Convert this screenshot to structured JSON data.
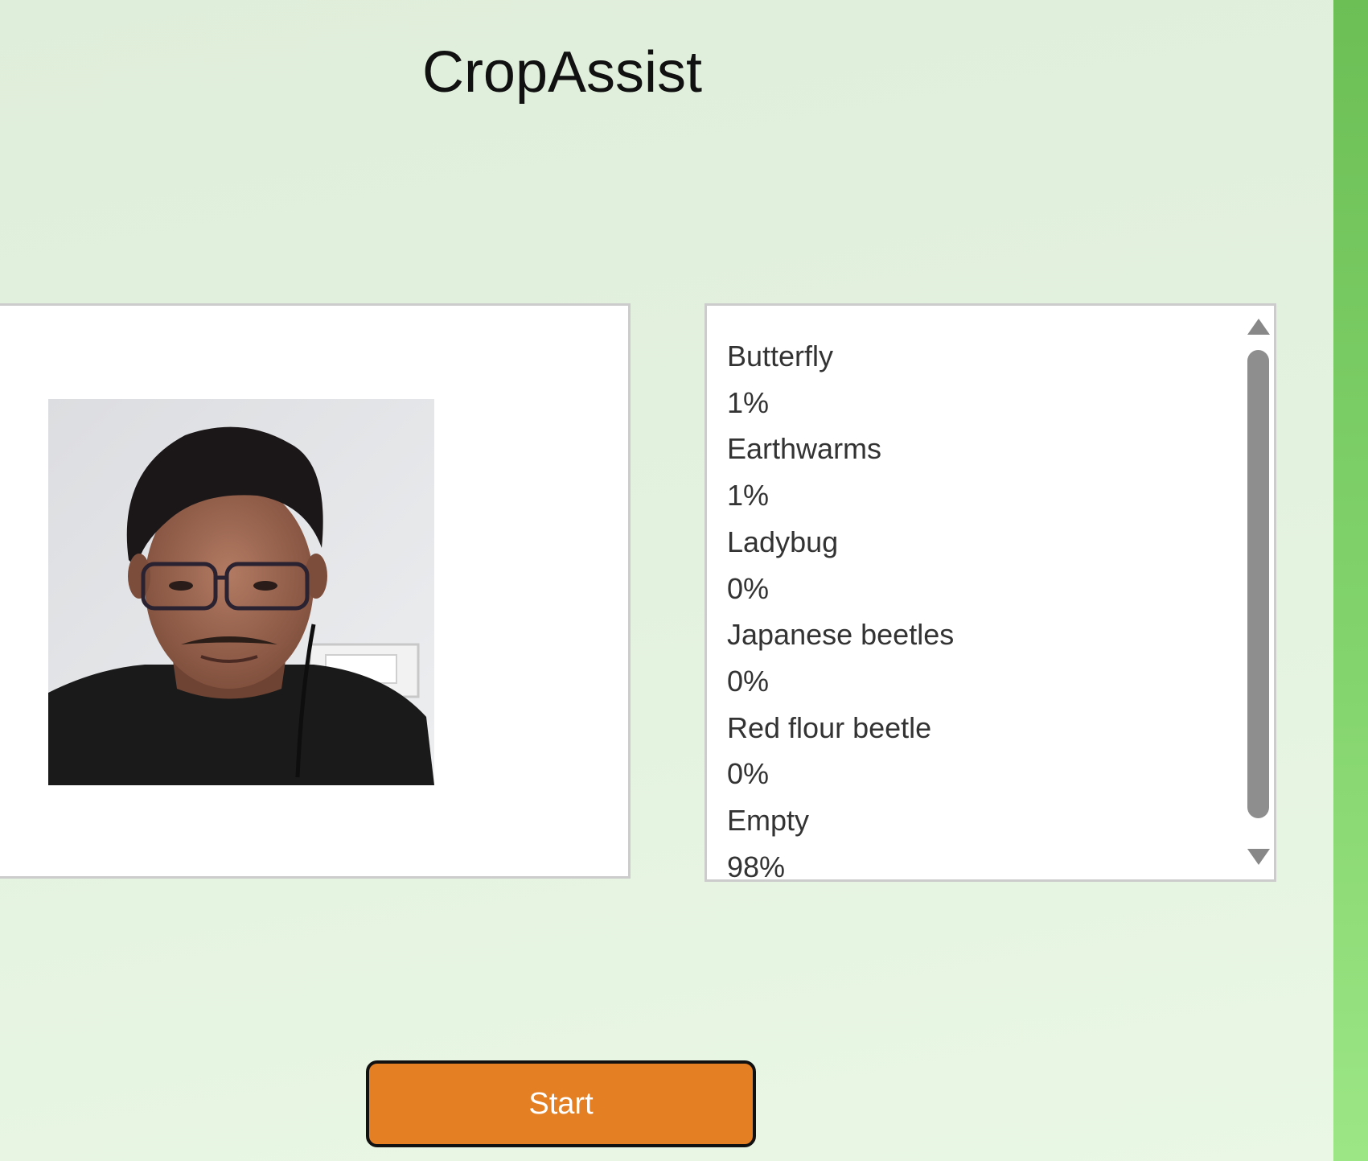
{
  "app": {
    "title": "CropAssist"
  },
  "camera": {
    "feed_icon": "webcam-person-icon"
  },
  "results": [
    {
      "label": "Butterfly",
      "value": "1%"
    },
    {
      "label": "Earthwarms",
      "value": "1%"
    },
    {
      "label": "Ladybug",
      "value": "0%"
    },
    {
      "label": "Japanese beetles",
      "value": "0%"
    },
    {
      "label": "Red flour beetle",
      "value": "0%"
    },
    {
      "label": "Empty",
      "value": "98%"
    }
  ],
  "controls": {
    "start_label": "Start"
  },
  "colors": {
    "accent": "#e57f23",
    "stripe": "#7ccb63",
    "background": "#e1f0dc"
  }
}
